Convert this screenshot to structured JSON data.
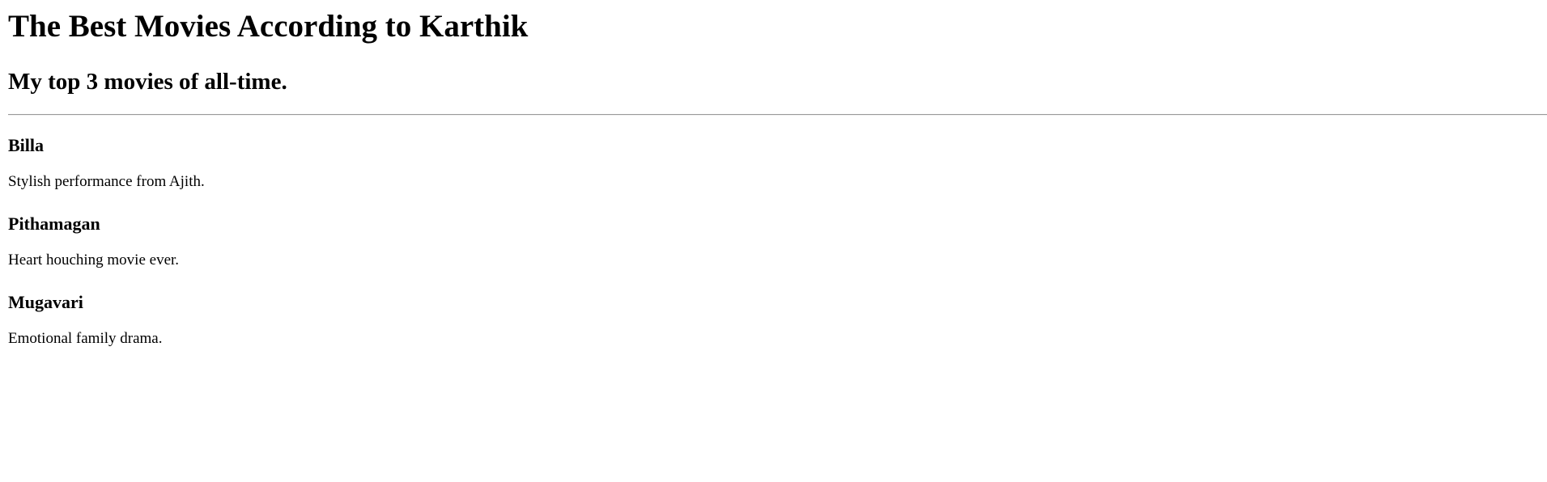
{
  "header": {
    "title": "The Best Movies According to Karthik",
    "subtitle": "My top 3 movies of all-time."
  },
  "movies": [
    {
      "name": "Billa",
      "description": "Stylish performance from Ajith."
    },
    {
      "name": "Pithamagan",
      "description": "Heart houching movie ever."
    },
    {
      "name": "Mugavari",
      "description": "Emotional family drama."
    }
  ]
}
